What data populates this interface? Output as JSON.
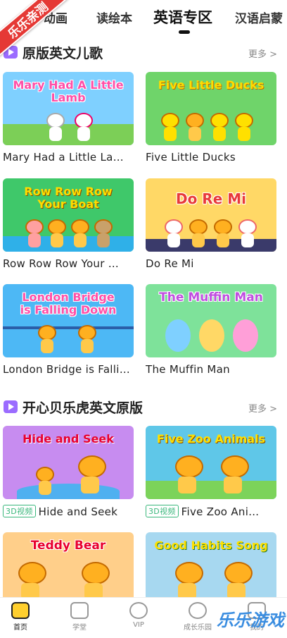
{
  "corner_badge": "乐乐亲测",
  "tabs": [
    {
      "label": "动画"
    },
    {
      "label": "读绘本"
    },
    {
      "label": "英语专区"
    },
    {
      "label": "汉语启蒙"
    }
  ],
  "sections": [
    {
      "title": "原版英文儿歌",
      "more": "更多 >",
      "items": [
        {
          "thumb": "Mary Had A Little Lamb",
          "label": "Mary Had a Little La…",
          "color": "#7fd0ff"
        },
        {
          "thumb": "Five Little Ducks",
          "label": "Five Little Ducks",
          "color": "#6fd46a"
        },
        {
          "thumb": "Row Row Row Your Boat",
          "label": "Row Row Row Your …",
          "color": "#3fc86a"
        },
        {
          "thumb": "Do Re Mi",
          "label": "Do Re Mi",
          "color": "#ffd866"
        },
        {
          "thumb": "London Bridge is Falling Down",
          "label": "London Bridge is Falli…",
          "color": "#4db8f5"
        },
        {
          "thumb": "The Muffin Man",
          "label": "The Muffin Man",
          "color": "#7ee29a"
        }
      ]
    },
    {
      "title": "开心贝乐虎英文原版",
      "more": "更多 >",
      "items": [
        {
          "thumb": "Hide and Seek",
          "badge": "3D视频",
          "label": "Hide and Seek",
          "color": "#c78cf0"
        },
        {
          "thumb": "Five Zoo Animals",
          "badge": "3D视频",
          "label": "Five Zoo Ani…",
          "color": "#5fc7e8"
        },
        {
          "thumb": "Teddy Bear",
          "label": "",
          "color": "#ffcf8a"
        },
        {
          "thumb": "Good Habits Song",
          "label": "",
          "color": "#a7d8f0"
        }
      ]
    }
  ],
  "bottom_nav": [
    {
      "label": "首页"
    },
    {
      "label": "学堂"
    },
    {
      "label": "VIP"
    },
    {
      "label": "成长乐园"
    },
    {
      "label": "我的"
    }
  ],
  "watermark": "乐乐游戏"
}
